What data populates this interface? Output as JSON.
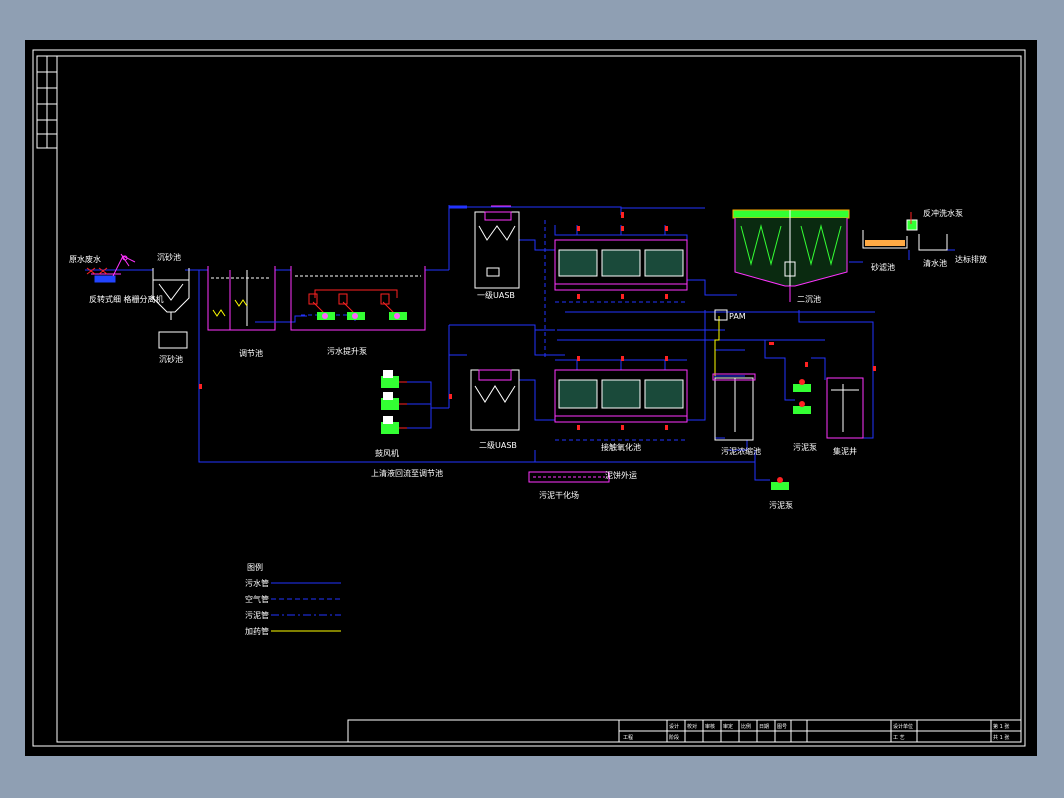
{
  "app": {
    "background_color": "#8f9fb3",
    "drawing_background": "#000000"
  },
  "colors": {
    "frame": "#ffffff",
    "sewage_pipe": "#2233ff",
    "sludge_pipe": "#4466ff",
    "dosing_pipe": "#ffff00",
    "equipment": "#ff33ff",
    "pump": "#33ff33",
    "valve": "#ff2222",
    "tank_fill": "#00c0c0"
  },
  "process": {
    "raw_water": "原水废水",
    "rotary_screen": "反转式细 格栅分离机",
    "sand_trap_top": "沉砂池",
    "sand_trap_bottom": "沉砂池",
    "equalization_tank": "调节池",
    "lift_pump": "污水提升泵",
    "uasb_1": "一级UASB",
    "uasb_2": "二级UASB",
    "blower": "鼓风机",
    "return_note": "上清液回流至调节池",
    "contact_oxidation": "接触氧化池",
    "secondary_clarifier": "二沉池",
    "sand_filter": "砂滤池",
    "clear_water_tank": "清水池",
    "discharge": "达标排放",
    "backwash_pump": "反冲洗水泵",
    "sludge_thickener": "污泥浓缩池",
    "sludge_pump_a": "污泥泵",
    "sludge_pump_b": "污泥泵",
    "sludge_well": "集泥井",
    "sludge_dewatering": "污泥干化场",
    "cake_transport": "泥饼外运",
    "pam": "PAM"
  },
  "legend": {
    "title": "图例",
    "items": [
      {
        "label": "污水管",
        "style": "solid",
        "color": "#2233ff"
      },
      {
        "label": "空气管",
        "style": "dashed",
        "color": "#2233ff"
      },
      {
        "label": "污泥管",
        "style": "dashdot",
        "color": "#2233ff"
      },
      {
        "label": "加药管",
        "style": "solid",
        "color": "#ffff00"
      }
    ]
  },
  "title_block": {
    "cells_top": [
      "设计",
      "校对",
      "审核",
      "审定",
      "比例",
      "日期",
      "图号"
    ],
    "cells_bottom": [
      "工程",
      "阶段"
    ],
    "right_top": "设计单位",
    "right_bottom": "工 艺",
    "sheet": "第 1 张",
    "sheet_total": "共 1 张"
  }
}
